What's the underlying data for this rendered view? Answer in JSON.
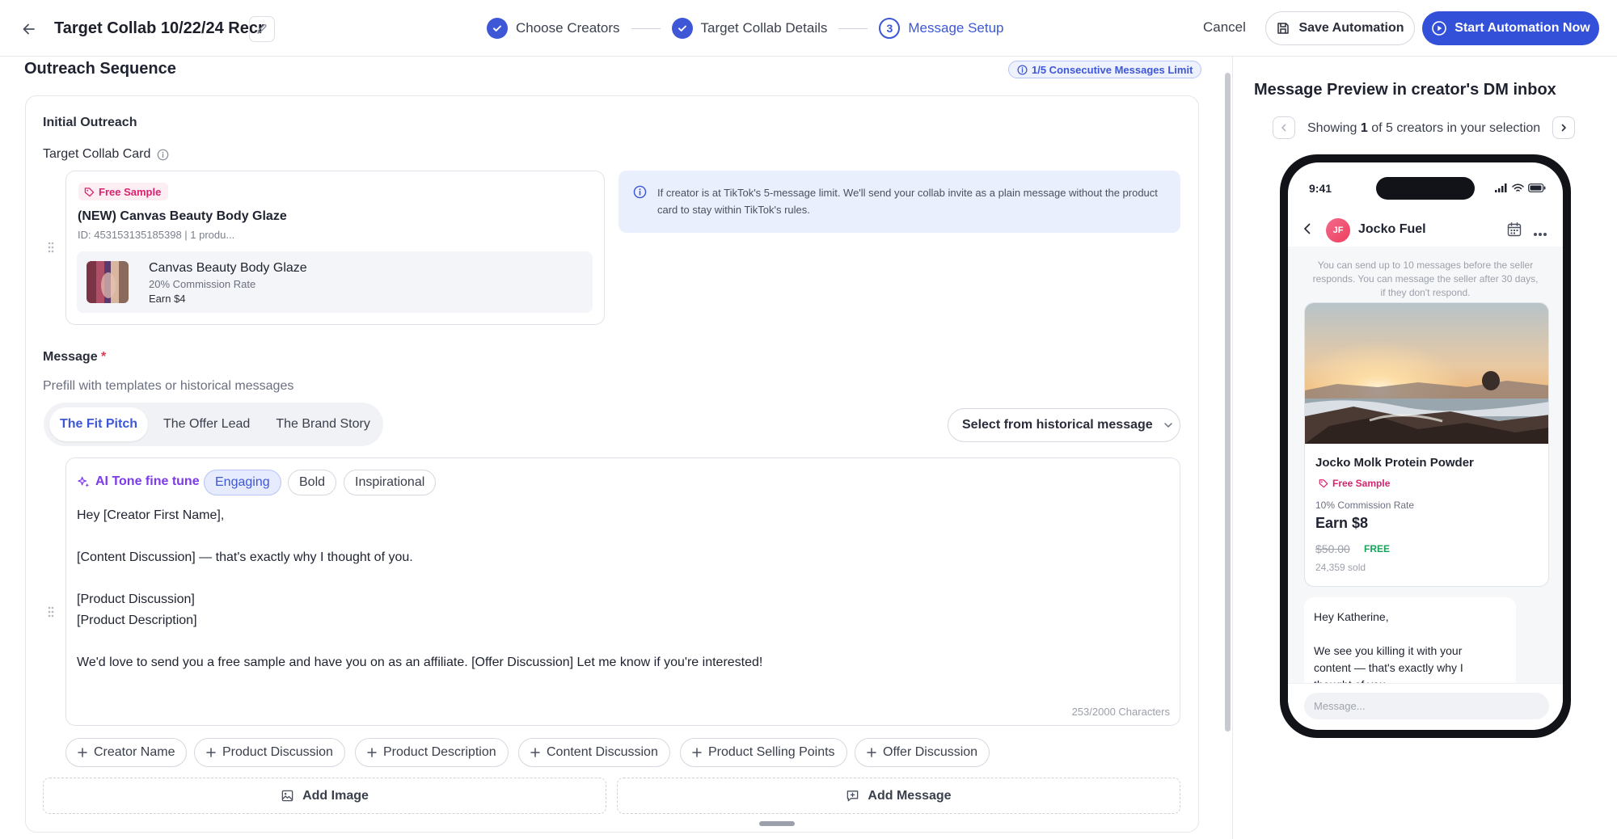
{
  "header": {
    "title": "Target Collab 10/22/24 Recr",
    "steps": [
      {
        "label": "Choose Creators"
      },
      {
        "label": "Target Collab Details"
      },
      {
        "label": "Message Setup",
        "number": "3"
      }
    ],
    "cancel": "Cancel",
    "save": "Save Automation",
    "start": "Start Automation Now"
  },
  "outreach": {
    "section_title": "Outreach Sequence",
    "limit_badge": "1/5 Consecutive Messages Limit",
    "initial_label": "Initial Outreach",
    "card_label": "Target Collab Card",
    "collab_card": {
      "badge": "Free Sample",
      "title": "(NEW) Canvas Beauty Body Glaze",
      "subtitle": "ID: 453153135185398 | 1 produ...",
      "product_name": "Canvas Beauty Body Glaze",
      "commission": "20% Commission Rate",
      "earn": "Earn $4"
    },
    "info_text": "If creator is at TikTok's 5-message limit. We'll send your collab invite as a plain message without the product card to stay within TikTok's rules.",
    "message_label": "Message",
    "required_mark": "*",
    "prefill_label": "Prefill with templates or historical messages",
    "templates": [
      "The Fit Pitch",
      "The Offer Lead",
      "The Brand Story"
    ],
    "historical_select": "Select from historical message",
    "ai_label": "AI Tone fine tune",
    "tones": [
      "Engaging",
      "Bold",
      "Inspirational"
    ],
    "message_lines": [
      "Hey [Creator First Name],",
      "[Content Discussion] — that's exactly why I thought of you.",
      "[Product Discussion]",
      "[Product Description]",
      "We'd love to send you a free sample and have you on as an affiliate. [Offer Discussion] Let me know if you're interested!"
    ],
    "char_count": "253/2000 Characters",
    "variables": [
      "Creator Name",
      "Product Discussion",
      "Product Description",
      "Content Discussion",
      "Product Selling Points",
      "Offer Discussion"
    ],
    "add_image": "Add Image",
    "add_message": "Add Message"
  },
  "preview": {
    "title": "Message Preview in creator's DM inbox",
    "showing_prefix": "Showing",
    "showing_current": "1",
    "showing_suffix": "of 5 creators in your selection",
    "phone": {
      "time": "9:41",
      "avatar_initials": "JF",
      "contact_name": "Jocko Fuel",
      "system_note": "You can send up to 10 messages before the seller responds. You can message the seller after 30 days, if they don't respond.",
      "product_name": "Jocko Molk Protein Powder",
      "badge": "Free Sample",
      "commission": "10% Commission Rate",
      "earn": "Earn $8",
      "old_price": "$50.00",
      "free_label": "FREE",
      "sold": "24,359 sold",
      "bubble_greeting": "Hey Katherine,",
      "bubble_body": "We see you killing it with your content — that's exactly why I thought of you.",
      "composer_placeholder": "Message..."
    }
  },
  "colors": {
    "primary": "#3350d8",
    "accent_blue": "#3d57d6",
    "ai_purple": "#7c3aed",
    "sample_pink": "#d6246f",
    "free_green": "#17a35a",
    "required_red": "#e0364f"
  }
}
